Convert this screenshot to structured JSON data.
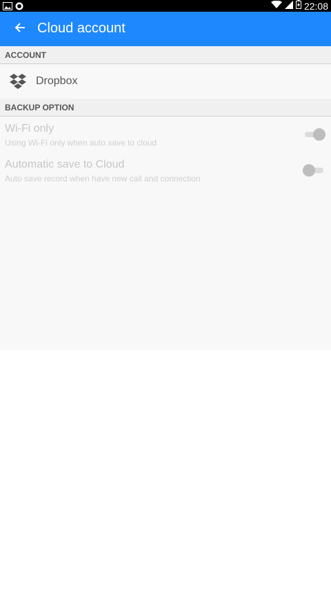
{
  "status_bar": {
    "time": "22:08",
    "left_icons": [
      "gallery-icon",
      "shield-icon"
    ],
    "right_icons": [
      "wifi-icon",
      "signal-icon",
      "battery-charging-icon"
    ]
  },
  "app_bar": {
    "title": "Cloud account",
    "back_icon": "arrow-left-icon",
    "color": "#1e88ff"
  },
  "sections": {
    "account": {
      "header": "ACCOUNT",
      "item": {
        "icon": "dropbox-icon",
        "label": "Dropbox"
      }
    },
    "backup": {
      "header": "BACKUP OPTION",
      "prefs": [
        {
          "title": "Wi-Fi only",
          "summary": "Using Wi-Fi only when auto save to cloud",
          "enabled": true
        },
        {
          "title": "Automatic save to Cloud",
          "summary": "Auto save record when have new call and connection",
          "enabled": false
        }
      ]
    }
  }
}
